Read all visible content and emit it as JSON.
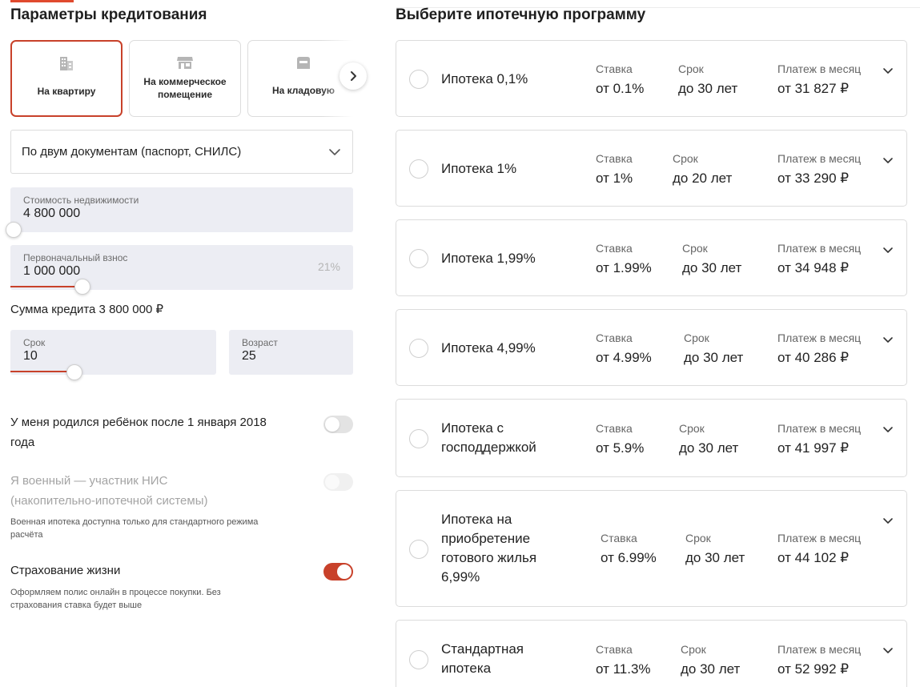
{
  "params": {
    "title": "Параметры кредитования",
    "property_types": [
      {
        "label": "На квартиру",
        "icon": "building-icon"
      },
      {
        "label": "На коммерческое помещение",
        "icon": "shop-icon"
      },
      {
        "label": "На кладовую",
        "icon": "storage-box-icon"
      }
    ],
    "documents_select": "По двум документам (паспорт, СНИЛС)",
    "property_cost": {
      "label": "Стоимость недвижимости",
      "value": "4 800 000"
    },
    "down_payment": {
      "label": "Первоначальный взнос",
      "value": "1 000 000",
      "percent": "21%"
    },
    "loan_sum": "Сумма кредита 3 800 000 ₽",
    "term": {
      "label": "Срок",
      "value": "10"
    },
    "age": {
      "label": "Возраст",
      "value": "25"
    },
    "child_toggle": {
      "text": "У меня родился ребёнок после 1 января 2018 года",
      "on": false
    },
    "military_toggle": {
      "text": "Я военный — участник НИС (накопительно-ипотечной системы)",
      "note": "Военная ипотека доступна только для стандартного режима расчёта",
      "disabled": true
    },
    "insurance_toggle": {
      "text": "Страхование жизни",
      "note": "Оформляем полис онлайн в процессе покупки. Без страхования ставка будет выше",
      "on": true
    }
  },
  "programs": {
    "title": "Выберите ипотечную программу",
    "rate_label": "Ставка",
    "term_label": "Срок",
    "payment_label": "Платеж в месяц",
    "items": [
      {
        "name": "Ипотека 0,1%",
        "rate": "от 0.1%",
        "term": "до 30 лет",
        "payment": "от 31 827 ₽"
      },
      {
        "name": "Ипотека 1%",
        "rate": "от 1%",
        "term": "до 20 лет",
        "payment": "от 33 290 ₽"
      },
      {
        "name": "Ипотека 1,99%",
        "rate": "от 1.99%",
        "term": "до 30 лет",
        "payment": "от 34 948 ₽"
      },
      {
        "name": "Ипотека 4,99%",
        "rate": "от 4.99%",
        "term": "до 30 лет",
        "payment": "от 40 286 ₽"
      },
      {
        "name": "Ипотека с господдержкой",
        "rate": "от 5.9%",
        "term": "до 30 лет",
        "payment": "от 41 997 ₽"
      },
      {
        "name": "Ипотека на приобретение готового жилья 6,99%",
        "rate": "от 6.99%",
        "term": "до 30 лет",
        "payment": "от 44 102 ₽"
      },
      {
        "name": "Стандартная ипотека",
        "rate": "от 11.3%",
        "term": "до 30 лет",
        "payment": "от 52 992 ₽"
      }
    ]
  },
  "colors": {
    "accent": "#c8412a",
    "field_bg": "#ecedf3",
    "border": "#dcdcdc"
  }
}
